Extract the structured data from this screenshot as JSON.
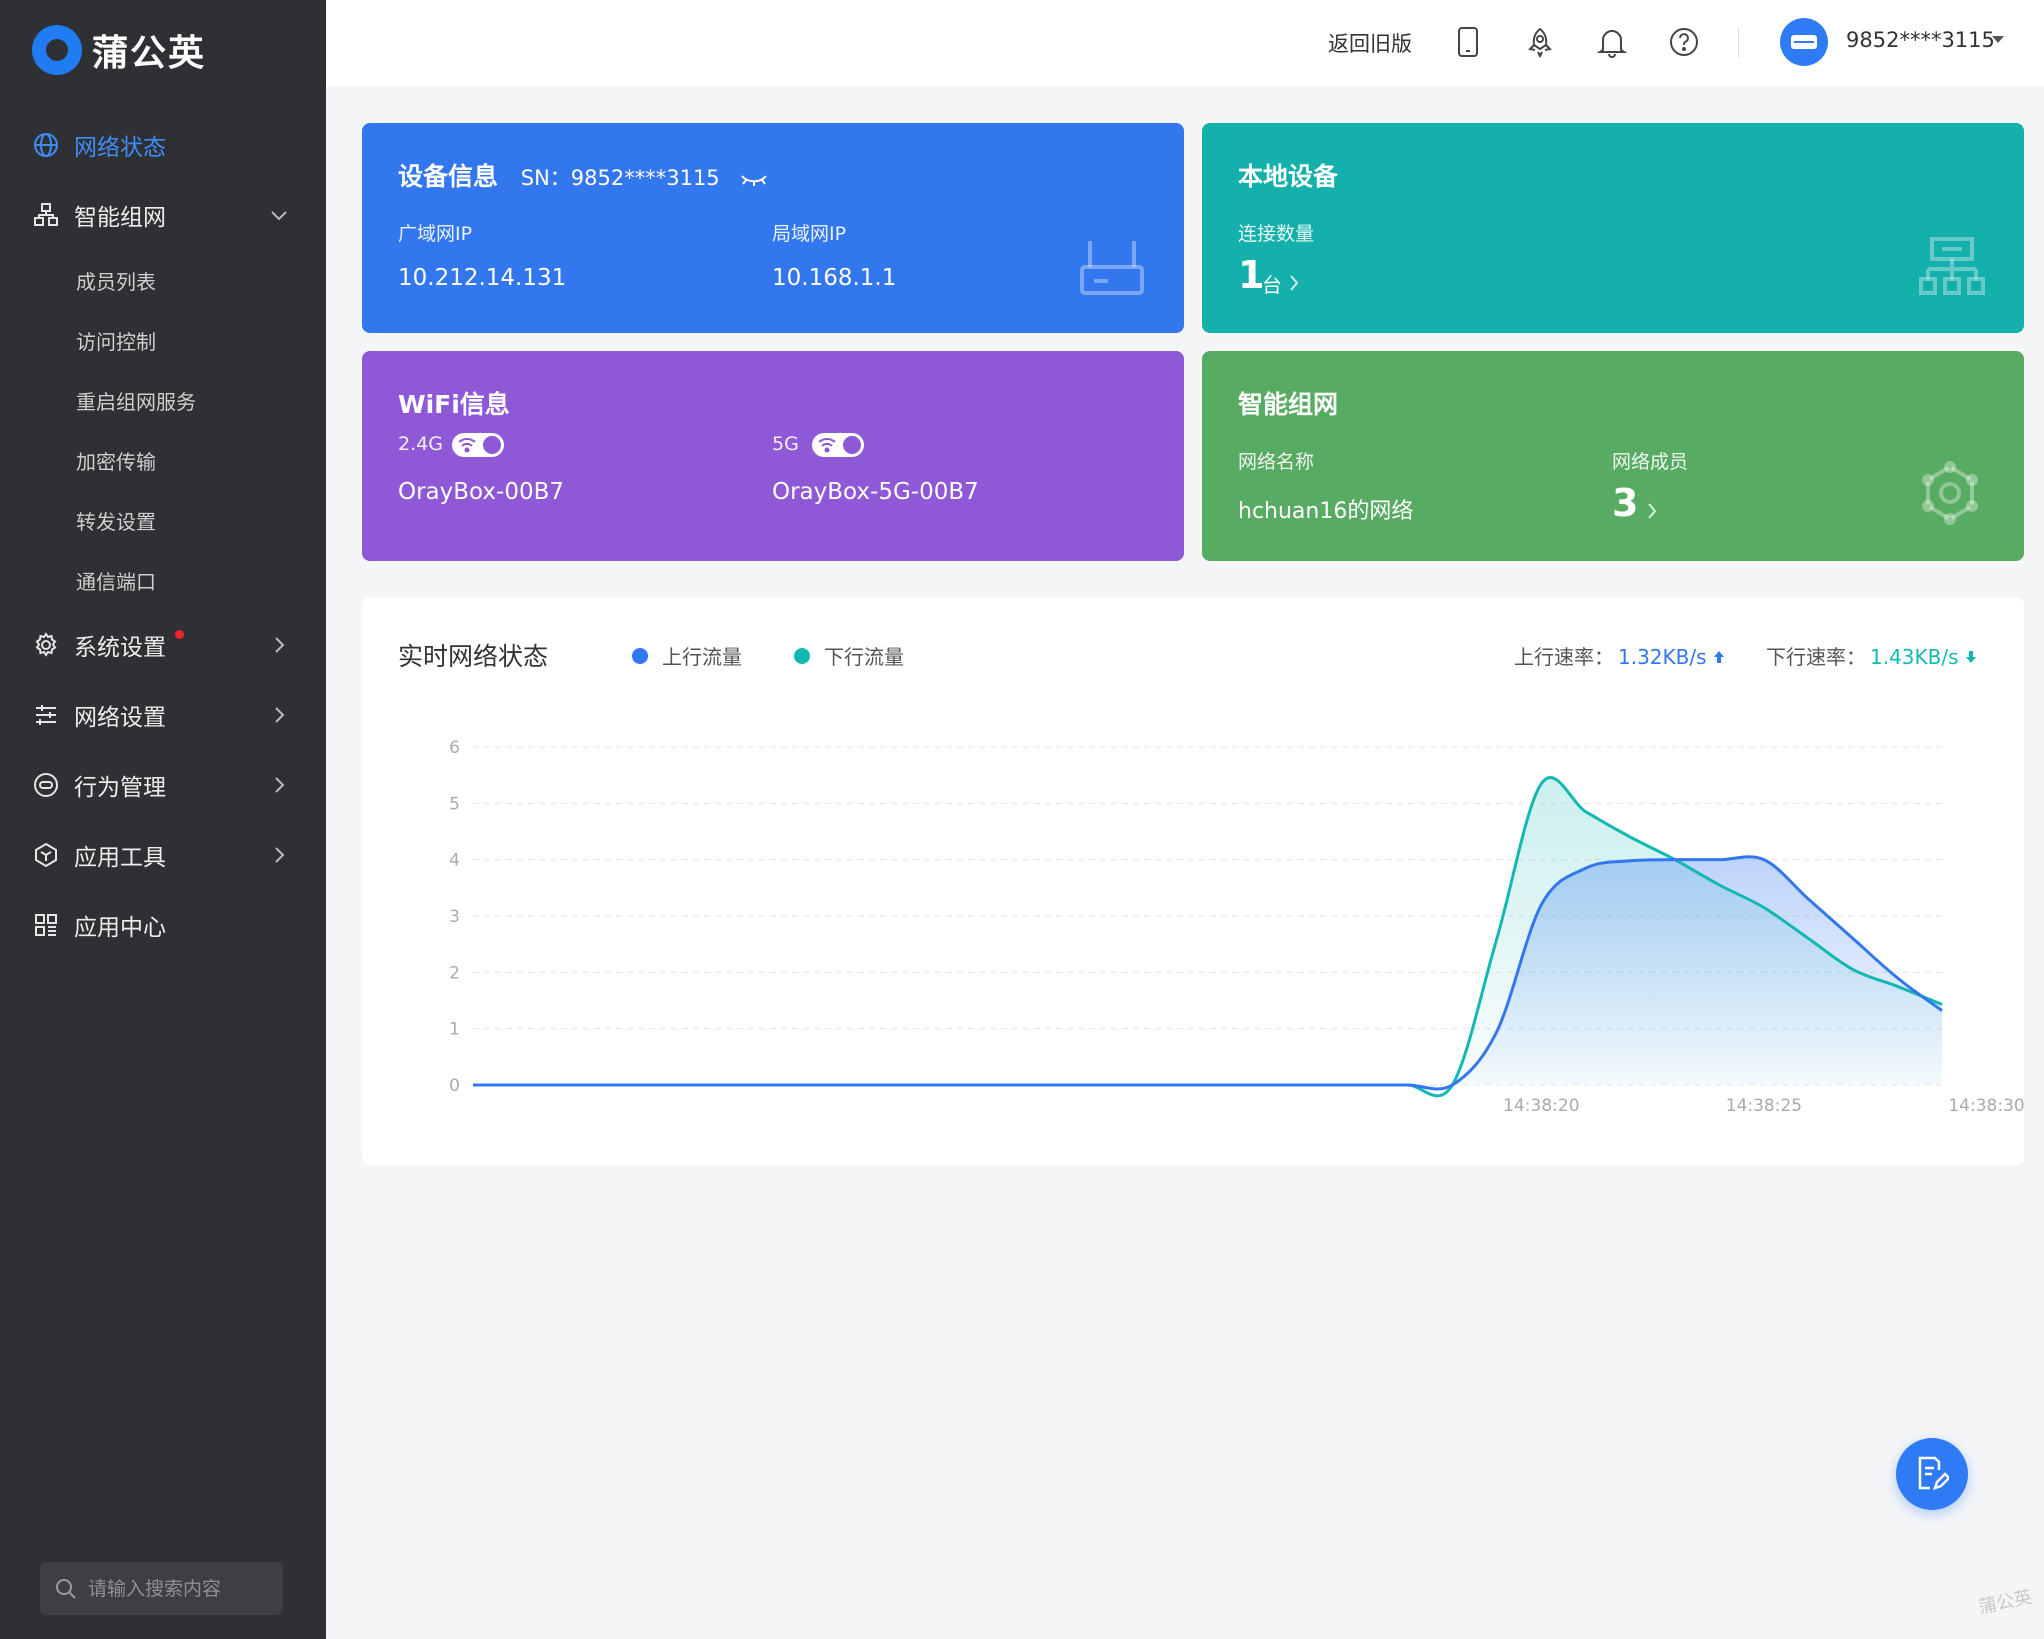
{
  "app": {
    "logo_text": "蒲公英",
    "watermark": "蒲公英"
  },
  "sidebar": {
    "items": [
      {
        "label": "网络状态",
        "icon": "globe-icon",
        "active": true
      },
      {
        "label": "智能组网",
        "icon": "network-nodes-icon",
        "expanded": true,
        "children": [
          "成员列表",
          "访问控制",
          "重启组网服务",
          "加密传输",
          "转发设置",
          "通信端口"
        ]
      },
      {
        "label": "系统设置",
        "icon": "gear-icon",
        "badge": true
      },
      {
        "label": "网络设置",
        "icon": "sliders-icon"
      },
      {
        "label": "行为管理",
        "icon": "behavior-icon"
      },
      {
        "label": "应用工具",
        "icon": "cube-icon"
      },
      {
        "label": "应用中心",
        "icon": "grid-icon"
      }
    ],
    "search_placeholder": "请输入搜索内容"
  },
  "header": {
    "back_link": "返回旧版",
    "icons": [
      "phone-icon",
      "rocket-icon",
      "bell-icon",
      "help-icon"
    ],
    "user": "9852****3115"
  },
  "device_card": {
    "title": "设备信息",
    "sn": "SN：9852****3115",
    "wan_label": "广域网IP",
    "wan_value": "10.212.14.131",
    "lan_label": "局域网IP",
    "lan_value": "10.168.1.1",
    "color": "#3377ef"
  },
  "local_card": {
    "title": "本地设备",
    "count_label": "连接数量",
    "count": "1",
    "unit": "台",
    "color": "#14b0ab"
  },
  "wifi_card": {
    "title": "WiFi信息",
    "band1": "2.4G",
    "ssid1": "OrayBox-00B7",
    "band2": "5G",
    "ssid2": "OrayBox-5G-00B7",
    "color": "#8e58d6"
  },
  "sdwan_card": {
    "title": "智能组网",
    "name_label": "网络名称",
    "name_value": "hchuan16的网络",
    "members_label": "网络成员",
    "members_value": "3",
    "color": "#58ab62"
  },
  "realtime": {
    "title": "实时网络状态",
    "legend_up": "上行流量",
    "legend_down": "下行流量",
    "up_rate_label": "上行速率：",
    "up_rate_value": "1.32KB/s",
    "down_rate_label": "下行速率：",
    "down_rate_value": "1.43KB/s",
    "up_color": "#3377ef",
    "down_color": "#14b8b3"
  },
  "chart_data": {
    "type": "area",
    "x": [
      "",
      "",
      "",
      "",
      "",
      "",
      "",
      "",
      "",
      "",
      "",
      "",
      "",
      "",
      "",
      "",
      "",
      "",
      "",
      "",
      "",
      "",
      "",
      "",
      "14:38:20",
      "",
      "",
      "",
      "",
      "14:38:25",
      "",
      "",
      "",
      "",
      "14:38:30"
    ],
    "x_ticks": [
      "14:38:20",
      "14:38:25",
      "14:38:30"
    ],
    "ylim": [
      0,
      6
    ],
    "y_ticks": [
      0,
      1,
      2,
      3,
      4,
      5,
      6
    ],
    "grid": true,
    "series": [
      {
        "name": "上行流量",
        "values": [
          0,
          0,
          0,
          0,
          0,
          0,
          0,
          0,
          0,
          0,
          0,
          0,
          0,
          0,
          0,
          0,
          0,
          0,
          0,
          0,
          0,
          0,
          0,
          0.95,
          3.2,
          3.85,
          3.98,
          4.0,
          4.0,
          4.0,
          3.3,
          2.6,
          1.9,
          1.32
        ]
      },
      {
        "name": "下行流量",
        "values": [
          0,
          0,
          0,
          0,
          0,
          0,
          0,
          0,
          0,
          0,
          0,
          0,
          0,
          0,
          0,
          0,
          0,
          0,
          0,
          0,
          0,
          0,
          0,
          2.6,
          5.35,
          4.85,
          4.4,
          4.0,
          3.55,
          3.15,
          2.6,
          2.05,
          1.75,
          1.43
        ]
      }
    ]
  }
}
